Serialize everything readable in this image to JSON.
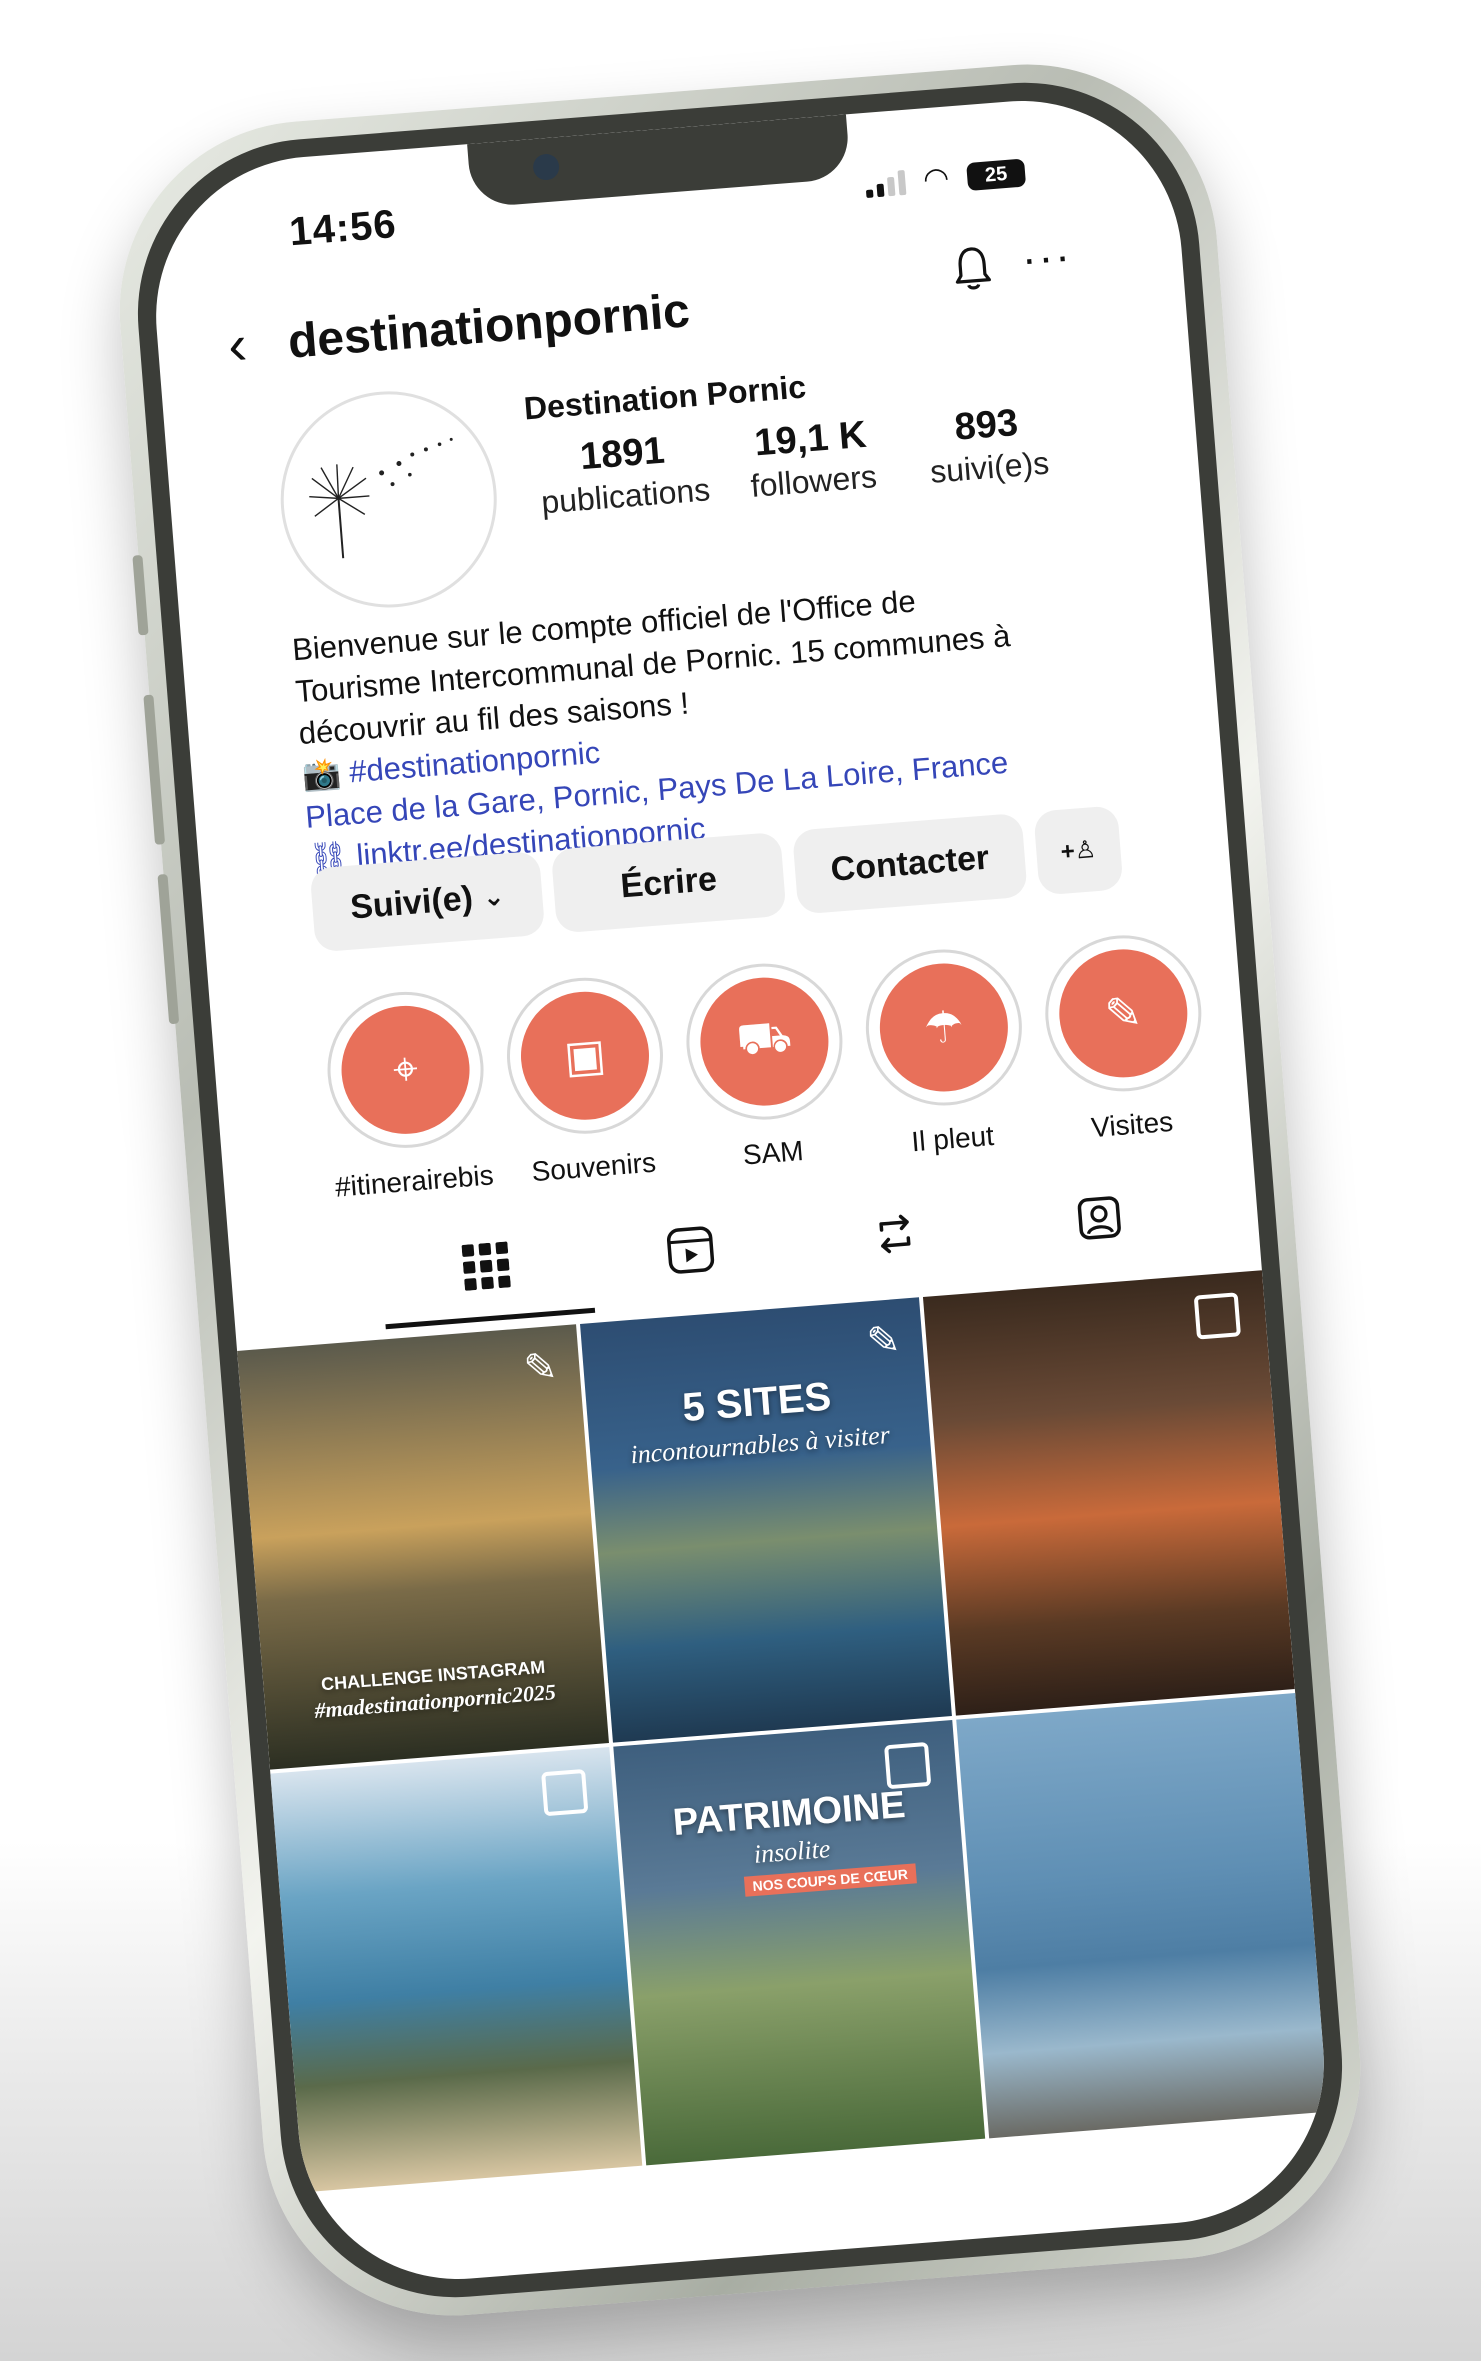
{
  "status_bar": {
    "time": "14:56",
    "battery": "25"
  },
  "header": {
    "username": "destinationpornic"
  },
  "profile": {
    "display_name": "Destination Pornic",
    "stats": [
      {
        "value": "1891",
        "label": "publications"
      },
      {
        "value": "19,1 K",
        "label": "followers"
      },
      {
        "value": "893",
        "label": "suivi(e)s"
      }
    ],
    "bio_lines": [
      "Bienvenue sur le compte officiel de l'Office de",
      "Tourisme Intercommunal de Pornic. 15 communes à",
      "découvrir au fil des saisons !"
    ],
    "hashtag": "📸 #destinationpornic",
    "location": "Place de la Gare, Pornic, Pays De La Loire, France",
    "link": "linktr.ee/destinationpornic"
  },
  "actions": {
    "follow": "Suivi(e)",
    "message": "Écrire",
    "contact": "Contacter"
  },
  "highlights": [
    {
      "label": "#itinerairebis",
      "icon": "route-pin-icon"
    },
    {
      "label": "Souvenirs",
      "icon": "suitcase-icon"
    },
    {
      "label": "SAM",
      "icon": "van-icon"
    },
    {
      "label": "Il pleut",
      "icon": "umbrella-icon"
    },
    {
      "label": "Visites",
      "icon": "ticket-icon"
    }
  ],
  "tabs": [
    {
      "icon": "grid-icon",
      "active": true
    },
    {
      "icon": "reels-icon",
      "active": false
    },
    {
      "icon": "reposts-icon",
      "active": false
    },
    {
      "icon": "tagged-icon",
      "active": false
    }
  ],
  "posts": [
    {
      "line1": "CHALLENGE INSTAGRAM",
      "line2": "#madestinationpornic2025",
      "badge": "pin"
    },
    {
      "line1": "SITES",
      "number": "5",
      "line2": "incontournables à visiter",
      "badge": "pin"
    },
    {
      "badge": "multi"
    },
    {
      "badge": "multi"
    },
    {
      "line1": "PATRIMOINE",
      "line2": "insolite",
      "line3": "NOS COUPS DE CŒUR",
      "badge": "multi"
    },
    {
      "badge": "none"
    }
  ],
  "colors": {
    "accent": "#e8705a",
    "link": "#3546b8",
    "button_bg": "#efefef"
  }
}
